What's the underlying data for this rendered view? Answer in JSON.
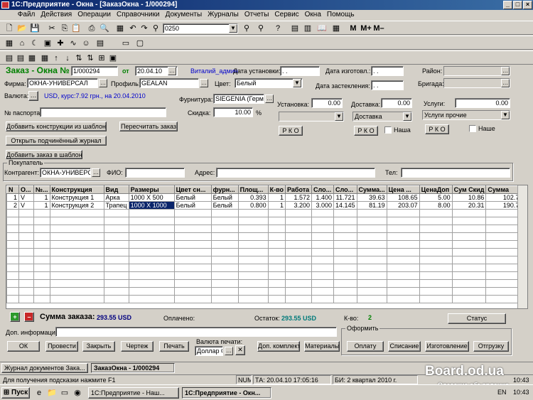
{
  "window": {
    "title": "1С:Предприятие - Окна - [ЗаказОкна - 1/000294]"
  },
  "menu": [
    "Файл",
    "Действия",
    "Операции",
    "Справочники",
    "Документы",
    "Журналы",
    "Отчеты",
    "Сервис",
    "Окна",
    "Помощь"
  ],
  "toolbar": {
    "search_value": "0250",
    "m_labels": [
      "М",
      "М+",
      "М–"
    ]
  },
  "doc": {
    "title": "Заказ - Окна №",
    "number": "1/000294",
    "date_label": "от",
    "date": "20.04.10",
    "user": "Виталий_админ",
    "install_date_label": "Дата установки:",
    "install_date": ". .",
    "make_date_label": "Дата изготовл.:",
    "make_date": ". .",
    "district_label": "Район:",
    "glazing_date_label": "Дата застекления:",
    "glazing_date": ". .",
    "brigade_label": "Бригада:"
  },
  "form": {
    "firm_label": "Фирма:",
    "firm": "ОКНА-УНИВЕРСАЛ",
    "profile_label": "Профиль:",
    "profile": "GEALAN",
    "color_label": "Цвет:",
    "color": "Белый",
    "currency_label": "Валюта:",
    "currency_info": "USD, курс:7.92 грн., на 20.04.2010",
    "furniture_label": "Фурнитура:",
    "furniture": "SIEGENIA (Герман",
    "passport_label": "№ паспорта:",
    "discount_label": "Скидка:",
    "discount": "10.00",
    "percent": "%",
    "install_label": "Установка:",
    "install": "0.00",
    "delivery_label": "Доставка:",
    "delivery": "0.00",
    "services_label": "Услуги:",
    "services": "0.00",
    "delivery_select": "Доставка",
    "services_select": "Услуги прочие",
    "rko": "Р К О",
    "ours": "Наша",
    "ours2": "Наше"
  },
  "buttons": {
    "add_constructions": "Добавить конструкции из шаблонов",
    "recalc": "Пересчитать заказ",
    "open_journal": "Открыть подчинённый журнал",
    "add_template": "Добавить заказ в шаблоны"
  },
  "buyer": {
    "group": "Покупатель",
    "contractor_label": "Контрагент:",
    "contractor": "ОКНА-УНИВЕРСА",
    "fio_label": "ФИО:",
    "address_label": "Адрес:",
    "phone_label": "Тел:"
  },
  "table": {
    "headers": [
      "N",
      "О...",
      "№...",
      "Конструкция",
      "Вид",
      "Размеры",
      "Цвет сн...",
      "фурн...",
      "Площ...",
      "К-во",
      "Работа",
      "Сло...",
      "Сло...",
      "Сумма...",
      "Цена ...",
      "ЦенаДоп",
      "Сум Скид",
      "Сумма"
    ],
    "rows": [
      [
        "1",
        "V",
        "1",
        "Конструкция 1",
        "Арка",
        "1000 X 500",
        "Белый",
        "Белый",
        "0.393",
        "1",
        "1.572",
        "1.400",
        "11.721",
        "39.63",
        "108.65",
        "5.00",
        "10.86",
        "102.79"
      ],
      [
        "2",
        "V",
        "1",
        "Конструкция 2",
        "Трапец",
        "1000 X 1000",
        "Белый",
        "Белый",
        "0.800",
        "1",
        "3.200",
        "3.000",
        "14.145",
        "81.19",
        "203.07",
        "8.00",
        "20.31",
        "190.76"
      ]
    ]
  },
  "footer": {
    "sum_label": "Сумма заказа:",
    "sum": "293.55 USD",
    "paid_label": "Оплачено:",
    "rest_label": "Остаток:",
    "rest": "293.55 USD",
    "qty_label": "К-во:",
    "qty": "2",
    "status": "Статус",
    "info_label": "Доп. информация:",
    "form_group": "Оформить",
    "print_currency_label": "Валюта печати:",
    "print_currency": "Доллар С",
    "ok": "ОК",
    "post": "Провести",
    "close": "Закрыть",
    "drawing": "Чертеж",
    "print": "Печать",
    "kit": "Доп. комплект",
    "materials": "Материалы",
    "payment": "Оплату",
    "writeoff": "Списание",
    "production": "Изготовление",
    "shipment": "Отгрузку"
  },
  "tabs": [
    "Журнал документов  Зака...",
    "ЗаказОкна - 1/000294"
  ],
  "statusbar": {
    "hint": "Для получения подсказки нажмите F1",
    "num": "NUM",
    "ta": "ТА: 20.04.10  17:05:16",
    "bi": "БИ: 2 квартал 2010 г.",
    "time": "10:43"
  },
  "taskbar": {
    "start": "Пуск",
    "items": [
      "1С:Предприятие - Наш...",
      "1С:Предприятие - Окн..."
    ],
    "clock": "10:43",
    "lang": "EN"
  },
  "watermark": {
    "site": "Board.od.ua",
    "sub": "Одесские объявления"
  }
}
